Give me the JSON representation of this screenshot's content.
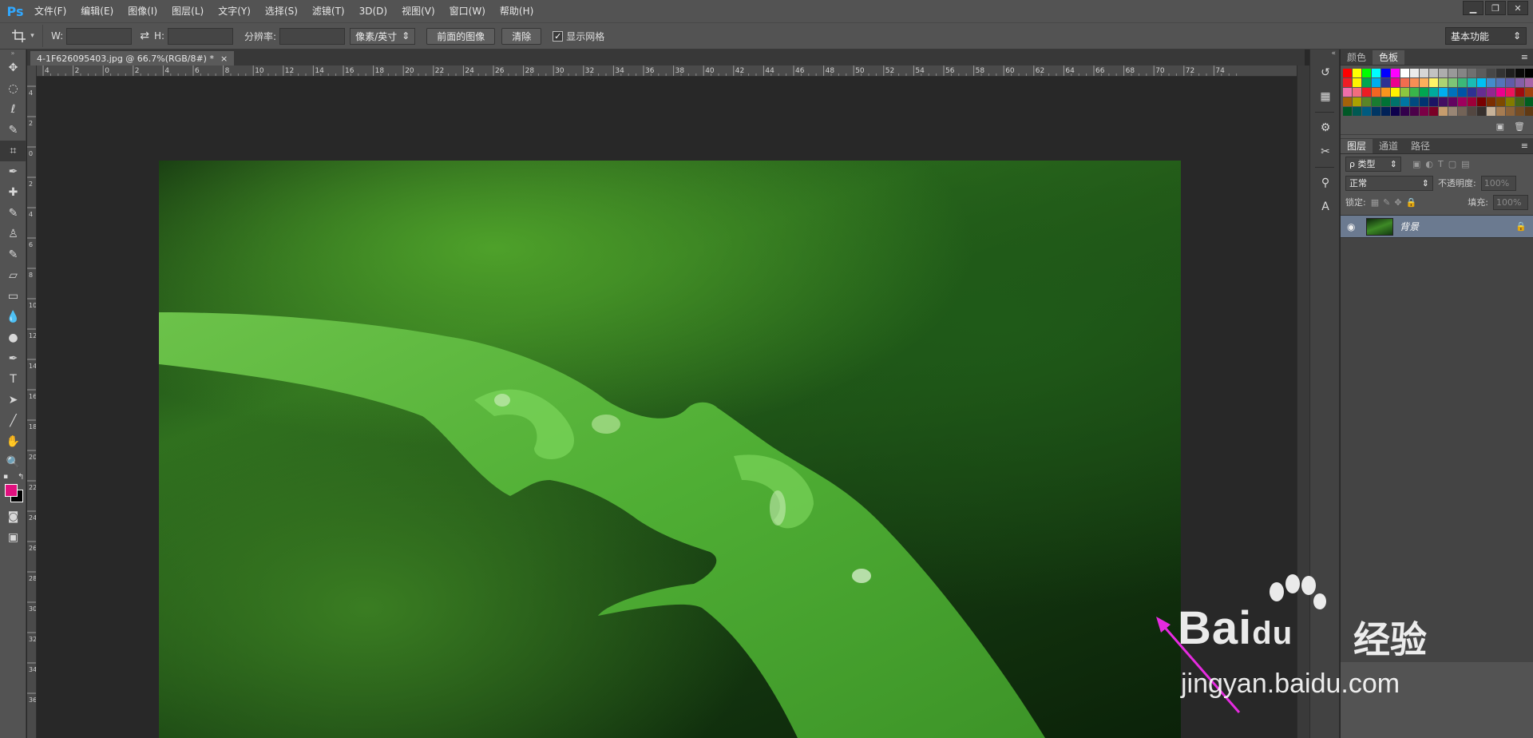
{
  "app": {
    "logo": "Ps"
  },
  "menu": [
    "文件(F)",
    "编辑(E)",
    "图像(I)",
    "图层(L)",
    "文字(Y)",
    "选择(S)",
    "滤镜(T)",
    "3D(D)",
    "视图(V)",
    "窗口(W)",
    "帮助(H)"
  ],
  "window_controls": [
    "▁",
    "❐",
    "✕"
  ],
  "options": {
    "w_label": "W:",
    "swap": "⇄",
    "h_label": "H:",
    "resolution_label": "分辨率:",
    "unit_select": "像素/英寸",
    "front_image_btn": "前面的图像",
    "clear_btn": "清除",
    "show_grid_label": "显示网格",
    "show_grid_checked": "✓",
    "workspace": "基本功能"
  },
  "document": {
    "tab_title": "4-1F626095403.jpg @ 66.7%(RGB/8#) *",
    "close": "×"
  },
  "ruler_h_labels": [
    "4",
    "2",
    "0",
    "2",
    "4",
    "6",
    "8",
    "10",
    "12",
    "14",
    "16",
    "18",
    "20",
    "22",
    "24",
    "26",
    "28",
    "30",
    "32",
    "34",
    "36",
    "38",
    "40",
    "42",
    "44",
    "46",
    "48",
    "50",
    "52",
    "54",
    "56",
    "58",
    "60",
    "62",
    "64",
    "66",
    "68",
    "70",
    "72",
    "74"
  ],
  "ruler_v_labels": [
    "4",
    "2",
    "0",
    "2",
    "4",
    "6",
    "8",
    "10",
    "12",
    "14",
    "16",
    "18",
    "20",
    "22",
    "24",
    "26",
    "28",
    "30",
    "32",
    "34",
    "36"
  ],
  "tools": [
    "move-icon",
    "marquee-icon",
    "lasso-icon",
    "quick-select-icon",
    "crop-icon",
    "eyedropper-icon",
    "healing-icon",
    "brush-icon",
    "stamp-icon",
    "history-brush-icon",
    "eraser-icon",
    "gradient-icon",
    "blur-icon",
    "dodge-icon",
    "pen-icon",
    "type-icon",
    "path-select-icon",
    "line-icon",
    "hand-icon",
    "zoom-icon"
  ],
  "tool_glyphs": [
    "✥",
    "◌",
    "ℓ",
    "✎",
    "⌗",
    "✒",
    "✚",
    "✎",
    "♙",
    "✎",
    "▱",
    "▭",
    "💧",
    "●",
    "✒",
    "T",
    "➤",
    "╱",
    "✋",
    "🔍"
  ],
  "colors": {
    "foreground": "#e0107e",
    "background": "#000000"
  },
  "dock_icons": [
    "history-icon",
    "properties-icon",
    "adjust-icon",
    "brush-preset-icon",
    "clone-source-icon",
    "character-icon"
  ],
  "dock_glyphs": [
    "↺",
    "▦",
    "⚙",
    "✂",
    "⚲",
    "A"
  ],
  "color_panel": {
    "tabs": [
      "颜色",
      "色板"
    ],
    "menu": "≡"
  },
  "swatches": [
    "#ff0000",
    "#ffff00",
    "#00ff00",
    "#00ffff",
    "#0000ff",
    "#ff00ff",
    "#ffffff",
    "#ebebeb",
    "#d6d6d6",
    "#c2c2c2",
    "#adadad",
    "#999999",
    "#858585",
    "#707070",
    "#5c5c5c",
    "#474747",
    "#333333",
    "#1f1f1f",
    "#0a0a0a",
    "#000000",
    "#ee1d24",
    "#fff200",
    "#00a650",
    "#00aeef",
    "#2e3192",
    "#ec008c",
    "#f26c4f",
    "#f68e55",
    "#fbaf5c",
    "#fff467",
    "#acd372",
    "#7cc576",
    "#3bb878",
    "#1abbb4",
    "#00bff3",
    "#438ccb",
    "#5574b9",
    "#605ca8",
    "#855fa8",
    "#a763a8",
    "#f06ea9",
    "#f26d7d",
    "#ed1c24",
    "#f26522",
    "#f7941d",
    "#fff200",
    "#8dc63f",
    "#39b54a",
    "#00a651",
    "#00a99d",
    "#00aeef",
    "#0072bc",
    "#0054a6",
    "#2e3192",
    "#662d91",
    "#92278f",
    "#ec008c",
    "#ed145b",
    "#9e0b0f",
    "#a0410d",
    "#a36209",
    "#aba000",
    "#598527",
    "#197b30",
    "#007236",
    "#00746b",
    "#0076a3",
    "#004b80",
    "#003471",
    "#1b1464",
    "#440e62",
    "#630460",
    "#9e005d",
    "#9e0039",
    "#790000",
    "#7b2e00",
    "#7d4900",
    "#827b00",
    "#406618",
    "#005e20",
    "#005826",
    "#005952",
    "#005b7f",
    "#003663",
    "#002157",
    "#0d004c",
    "#32004b",
    "#4b0049",
    "#7b0046",
    "#7a0026",
    "#c69c6d",
    "#998675",
    "#736357",
    "#534741",
    "#37302d",
    "#c7b299",
    "#a67c52",
    "#8c6239",
    "#754c24",
    "#603913"
  ],
  "layers_panel": {
    "tabs": [
      "图层",
      "通道",
      "路径"
    ],
    "menu": "≡",
    "filter": "ρ 类型",
    "blend_mode": "正常",
    "opacity_label": "不透明度:",
    "opacity_value": "100%",
    "lock_label": "锁定:",
    "fill_label": "填充:",
    "fill_value": "100%",
    "layers": [
      {
        "name": "背景",
        "visible": "◉",
        "locked": "🔒"
      }
    ]
  },
  "watermark": {
    "brand": "Bai",
    "brand2": "du",
    "cn": "经验",
    "url": "jingyan.baidu.com"
  }
}
